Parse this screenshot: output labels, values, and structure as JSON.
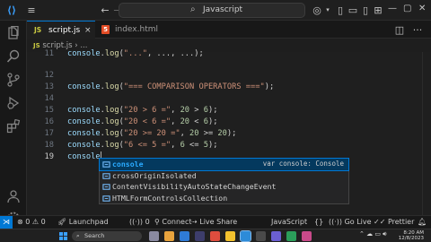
{
  "window": {
    "search_text": "Javascript"
  },
  "tabs": [
    {
      "badge": "JS",
      "label": "script.js",
      "close": "×",
      "active": true
    },
    {
      "badge": "5",
      "label": "index.html",
      "active": false
    }
  ],
  "breadcrumb": {
    "badge": "JS",
    "label": "script.js",
    "separator": "›",
    "tail": "..."
  },
  "editor": {
    "lines": [
      {
        "number": "11",
        "text": "console.log(\"...\", ..., ...);"
      },
      {
        "number": "12",
        "text": ""
      },
      {
        "number": "13",
        "text": "console.log(\"=== COMPARISON OPERATORS ===\");"
      },
      {
        "number": "14",
        "text": ""
      },
      {
        "number": "15",
        "text": "console.log(\"20 > 6 =\", 20 > 6);"
      },
      {
        "number": "16",
        "text": "console.log(\"20 < 6 =\", 20 < 6);"
      },
      {
        "number": "17",
        "text": "console.log(\"20 >= 20 =\", 20 >= 20);"
      },
      {
        "number": "18",
        "text": "console.log(\"6 <= 5 =\", 6 <= 5);"
      },
      {
        "number": "19",
        "text": "console",
        "current": true
      }
    ]
  },
  "suggestions": {
    "items": [
      {
        "label": "console",
        "detail": "var console: Console",
        "selected": true
      },
      {
        "label": "crossOriginIsolated"
      },
      {
        "label": "ContentVisibilityAutoStateChangeEvent"
      },
      {
        "label": "HTMLFormControlsCollection"
      }
    ]
  },
  "statusbar": {
    "errors": "0",
    "warnings": "0",
    "launchpad": "Launchpad",
    "info": "0",
    "connect": "Connect",
    "live_share": "Live Share",
    "language": "JavaScript",
    "go_live": "Go Live",
    "prettier": "Prettier"
  },
  "taskbar": {
    "search_placeholder": "Search",
    "time": "8:20 AM",
    "date": "12/8/2023"
  },
  "colors": {
    "accent": "#0078d4",
    "html_badge": "#e44d26",
    "js_badge": "#cbcb41"
  }
}
